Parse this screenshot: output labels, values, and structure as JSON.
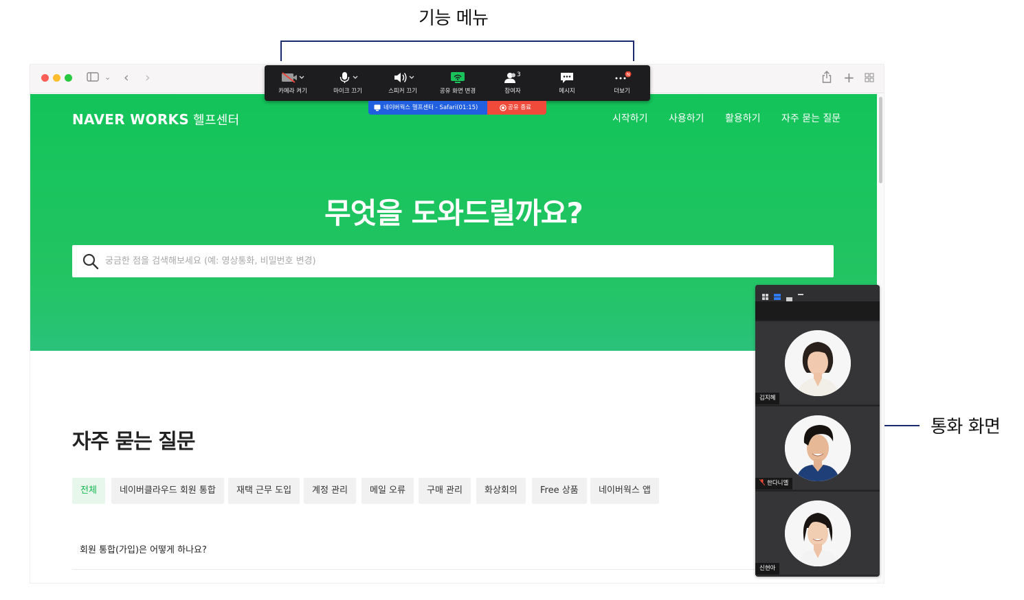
{
  "annotations": {
    "toolbar_caption": "기능 메뉴",
    "call_caption": "통화 화면"
  },
  "site": {
    "brand": "NAVER WORKS",
    "brand_sub": "헬프센터",
    "nav": [
      "시작하기",
      "사용하기",
      "활용하기",
      "자주 묻는 질문"
    ],
    "headline": "무엇을 도와드릴까요?",
    "search_placeholder": "궁금한 점을 검색해보세요 (예: 영상통화, 비밀번호 변경)",
    "faq_title": "자주 묻는 질문",
    "faq_tabs": [
      "전체",
      "네이버클라우드 회원 통합",
      "재택 근무 도입",
      "계정 관리",
      "메일 오류",
      "구매 관리",
      "화상회의",
      "Free 상품",
      "네이버웍스 앱"
    ],
    "faq_active_tab": "전체",
    "question": "회원 통합(가입)은 어떻게 하나요?"
  },
  "toolbar": {
    "items": [
      {
        "label": "카메라 켜기",
        "icon": "camera-off-icon"
      },
      {
        "label": "마이크 끄기",
        "icon": "microphone-icon"
      },
      {
        "label": "스피커 끄기",
        "icon": "speaker-icon"
      },
      {
        "label": "공유 화면 변경",
        "icon": "screen-share-icon"
      },
      {
        "label": "참여자",
        "icon": "participants-icon",
        "badge": "3"
      },
      {
        "label": "메시지",
        "icon": "message-icon"
      },
      {
        "label": "더보기",
        "icon": "more-icon",
        "badge": "N"
      }
    ],
    "sharing_text": "네이버웍스 헬프센터 - Safari(01:15)",
    "stop_share_label": "공유 종료"
  },
  "call": {
    "participants": [
      {
        "name": "김지혜",
        "muted": false
      },
      {
        "name": "한다니엘",
        "muted": true
      },
      {
        "name": "신현아",
        "muted": false
      }
    ]
  },
  "colors": {
    "hero_green": "#1fc35e",
    "toolbar_bg": "#1d1d1f",
    "share_blue": "#1f5fe0",
    "stop_red": "#ef4a3a",
    "annotation_navy": "#1a2a6c"
  }
}
